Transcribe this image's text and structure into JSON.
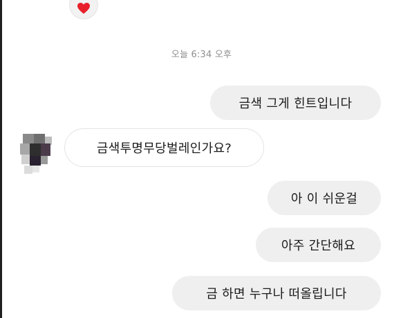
{
  "conversation": {
    "reaction_icon": "heart-icon",
    "timestamp": "오늘 6:34 오후",
    "messages": [
      {
        "side": "outgoing",
        "text": "금색 그게 힌트입니다"
      },
      {
        "side": "incoming",
        "text": "금색투명무당벌레인가요?"
      },
      {
        "side": "outgoing",
        "text": "아 이 쉬운걸"
      },
      {
        "side": "outgoing",
        "text": "아주 간단해요"
      },
      {
        "side": "outgoing",
        "text": "금  하면 누구나 떠올립니다"
      }
    ]
  },
  "colors": {
    "outgoing_bubble": "#efefef",
    "incoming_bubble_border": "#e3e3e3",
    "timestamp_text": "#8e8e8e",
    "heart": "#e8202a"
  }
}
